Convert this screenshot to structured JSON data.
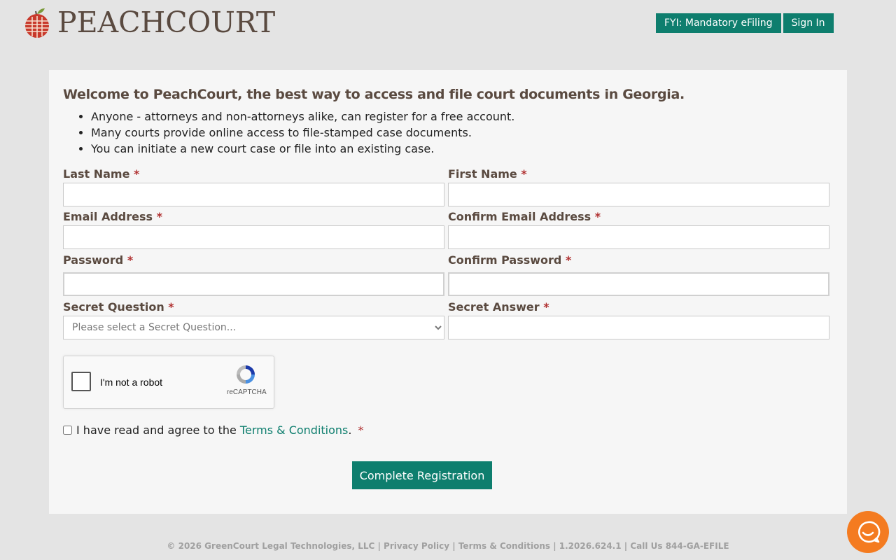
{
  "header": {
    "logo_text": "PEACHCOURT",
    "nav": [
      "FYI: Mandatory eFiling",
      "Sign In"
    ]
  },
  "intro": {
    "heading": "Welcome to PeachCourt, the best way to access and file court documents in Georgia.",
    "bullets": [
      "Anyone - attorneys and non-attorneys alike, can register for a free account.",
      "Many courts provide online access to file-stamped case documents.",
      "You can initiate a new court case or file into an existing case."
    ]
  },
  "form": {
    "last_name": "Last Name",
    "first_name": "First Name",
    "email": "Email Address",
    "confirm_email": "Confirm Email Address",
    "password": "Password",
    "confirm_password": "Confirm Password",
    "secret_question": "Secret Question",
    "secret_question_placeholder": "Please select a Secret Question...",
    "secret_answer": "Secret Answer",
    "required_mark": "*"
  },
  "captcha": {
    "label": "I'm not a robot",
    "brand": "reCAPTCHA"
  },
  "agree": {
    "prefix": "I have read and agree to the",
    "link": "Terms & Conditions",
    "suffix": "."
  },
  "submit_label": "Complete Registration",
  "footer": {
    "text": "© 2026 GreenCourt Legal Technologies, LLC | Privacy Policy | Terms & Conditions | 1.2026.624.1 | Call Us 844-GA-EFILE"
  },
  "colors": {
    "accent": "#0e7e6e",
    "brand_text": "#5a4a40",
    "required": "#b03030",
    "chat": "#f47b20"
  }
}
